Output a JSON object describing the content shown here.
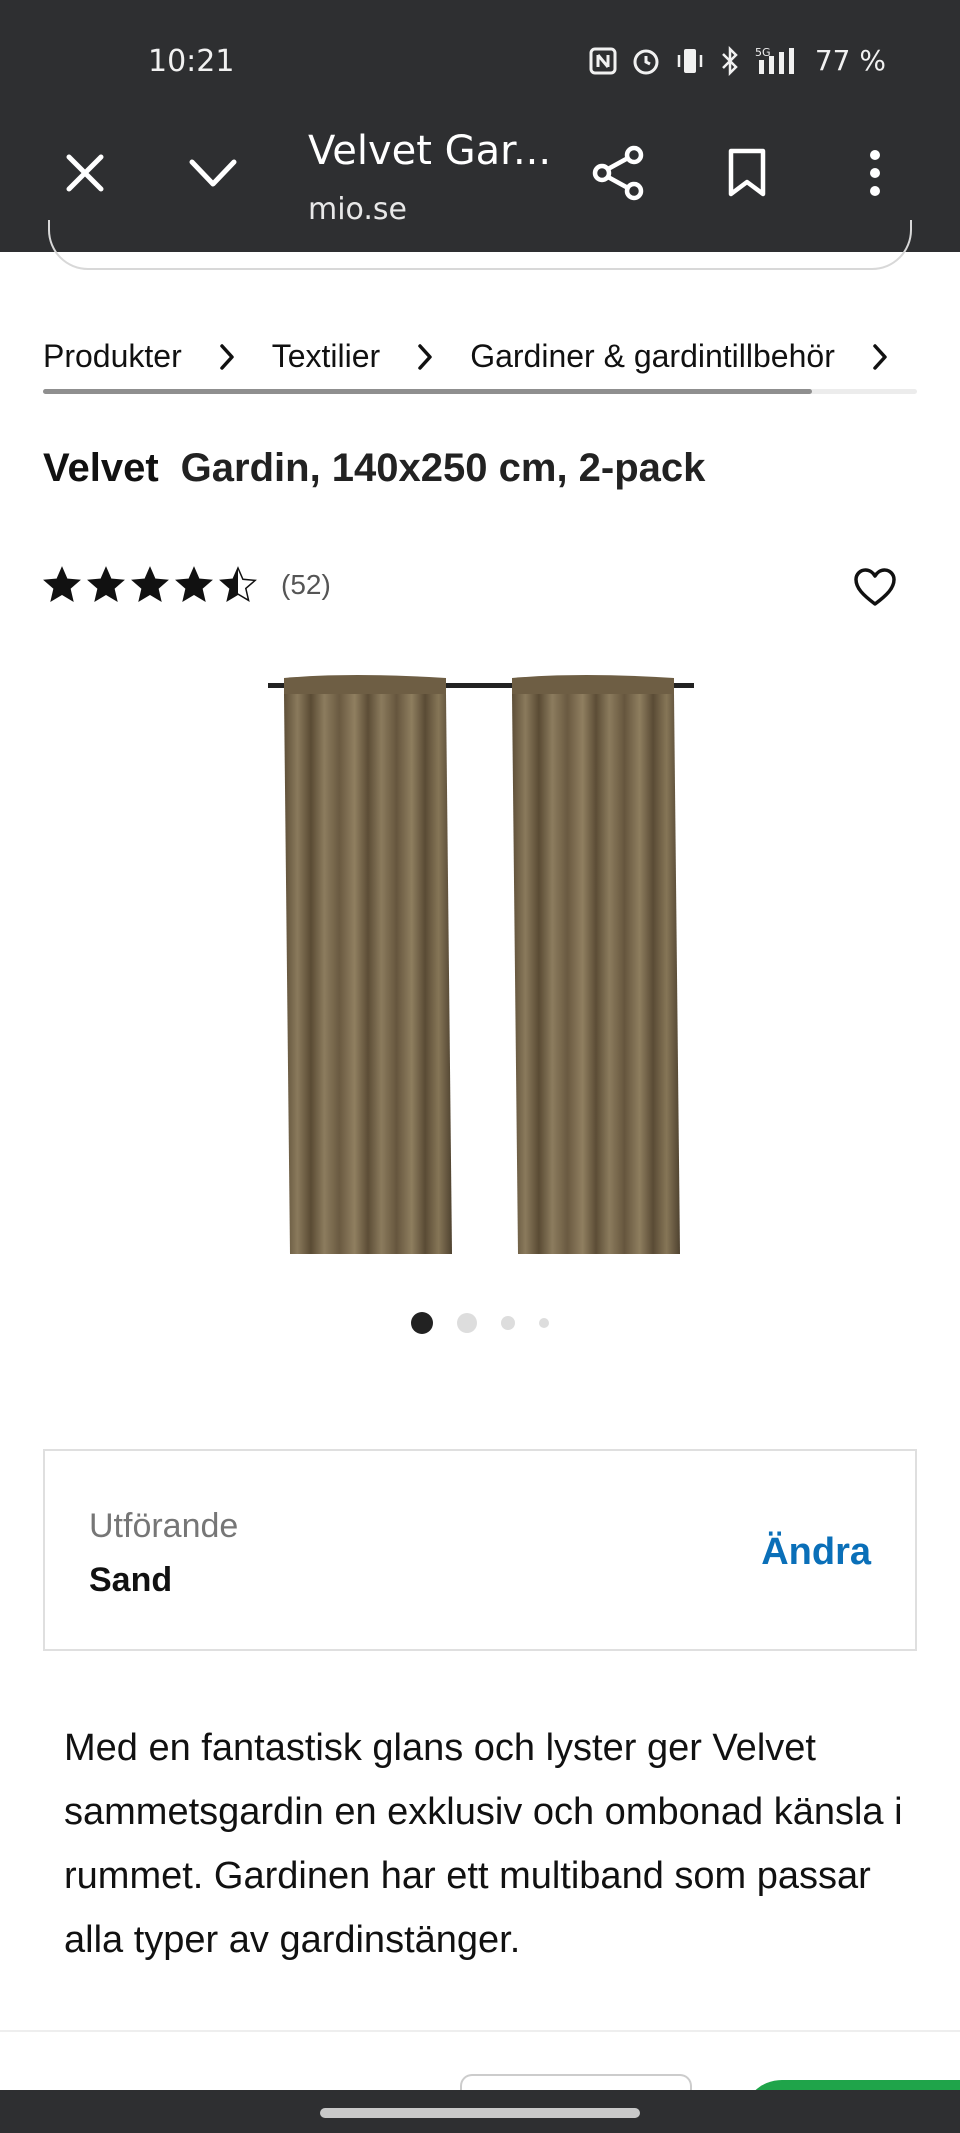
{
  "status_bar": {
    "time": "10:21",
    "network": "5G",
    "battery": "77 %",
    "icons": [
      "nfc-icon",
      "alarm-icon",
      "vibrate-icon",
      "bluetooth-icon",
      "signal-icon"
    ]
  },
  "tab_bar": {
    "title": "Velvet Gar...",
    "url": "mio.se",
    "icons": [
      "close-icon",
      "chevron-down-icon",
      "share-icon",
      "bookmark-icon",
      "more-vert-icon"
    ]
  },
  "breadcrumb": {
    "items": [
      "Produkter",
      "Textilier",
      "Gardiner & gardintillbehör"
    ],
    "scroll_fraction": 0.88
  },
  "product": {
    "name": "Velvet",
    "description": "Gardin, 140x250 cm, 2-pack",
    "rating": 4.5,
    "review_count": "(52)",
    "image_icon": "curtain-product-image"
  },
  "carousel": {
    "count": 4,
    "active_index": 0
  },
  "variant": {
    "label": "Utförande",
    "value": "Sand",
    "change_label": "Ändra"
  },
  "body_text": "Med en fantastisk glans och lyster ger Velvet sammetsgardin en exklusiv och ombonad känsla i rummet. Gardinen har ett multiband som passar alla typer av gardinstänger.",
  "colors": {
    "toolbar_bg": "#2e2f31",
    "link_blue": "#0a6fb8",
    "curtain": "#7a6a4f",
    "cta_green": "#1fa44a"
  }
}
